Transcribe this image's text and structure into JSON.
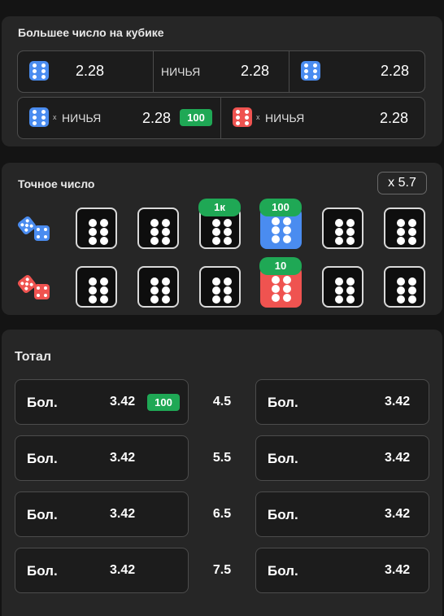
{
  "higher_panel": {
    "title": "Большее число на кубике",
    "row1": [
      {
        "odds": "2.28"
      },
      {
        "label": "НИЧЬЯ",
        "odds": "2.28"
      },
      {
        "odds": "2.28"
      }
    ],
    "row2": [
      {
        "prefix": "x",
        "label": "НИЧЬЯ",
        "odds": "2.28",
        "badge": "100"
      },
      {
        "prefix": "x",
        "label": "НИЧЬЯ",
        "odds": "2.28"
      }
    ]
  },
  "exact_panel": {
    "title": "Точное число",
    "multiplier": "x 5.7",
    "blue_row_badges": {
      "d3": "1к",
      "d4": "100"
    },
    "red_row_badges": {
      "d4": "10"
    }
  },
  "total_panel": {
    "title": "Тотал",
    "rows": [
      {
        "left_label": "Бол.",
        "left_odds": "3.42",
        "left_badge": "100",
        "line": "4.5",
        "right_label": "Бол.",
        "right_odds": "3.42"
      },
      {
        "left_label": "Бол.",
        "left_odds": "3.42",
        "line": "5.5",
        "right_label": "Бол.",
        "right_odds": "3.42"
      },
      {
        "left_label": "Бол.",
        "left_odds": "3.42",
        "line": "6.5",
        "right_label": "Бол.",
        "right_odds": "3.42"
      },
      {
        "left_label": "Бол.",
        "left_odds": "3.42",
        "line": "7.5",
        "right_label": "Бол.",
        "right_odds": "3.42"
      }
    ]
  },
  "colors": {
    "blue_die": "#4a8cf0",
    "red_die": "#ef5350",
    "badge_green": "#1fa855",
    "panel": "#262626"
  }
}
